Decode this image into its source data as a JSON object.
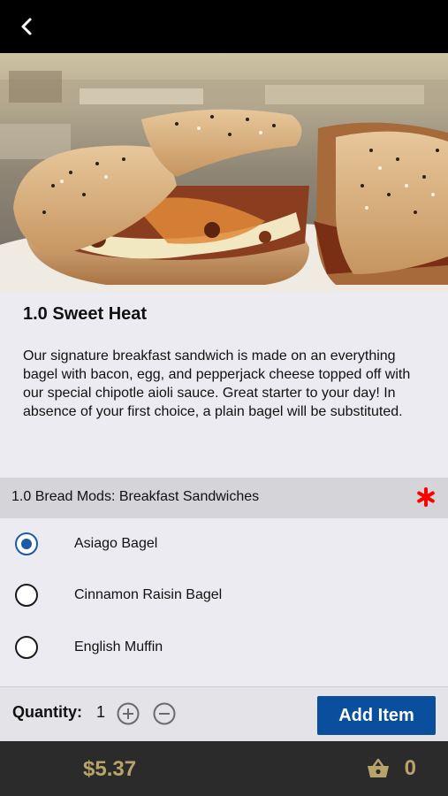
{
  "header": {
    "back_icon": "chevron-left-icon"
  },
  "item": {
    "title": "1.0 Sweet Heat",
    "description": "Our signature breakfast sandwich is made on an everything bagel with bacon, egg, and pepperjack cheese topped off with our special chipotle aioli sauce.  Great starter to your day!  In absence of your first choice, a plain bagel will be substituted."
  },
  "modifiers": {
    "group_label": "1.0 Bread Mods: Breakfast Sandwiches",
    "required_color": "#ff0000",
    "options": [
      {
        "label": "Asiago Bagel",
        "selected": true
      },
      {
        "label": "Cinnamon Raisin Bagel",
        "selected": false
      },
      {
        "label": "English Muffin",
        "selected": false
      }
    ]
  },
  "quantity": {
    "label": "Quantity:",
    "value": "1"
  },
  "actions": {
    "add_label": "Add Item"
  },
  "footer": {
    "price": "$5.37",
    "cart_count": "0"
  },
  "colors": {
    "accent": "#0a4e9e",
    "gold": "#b8a46a",
    "bar": "#2b2b2b"
  }
}
